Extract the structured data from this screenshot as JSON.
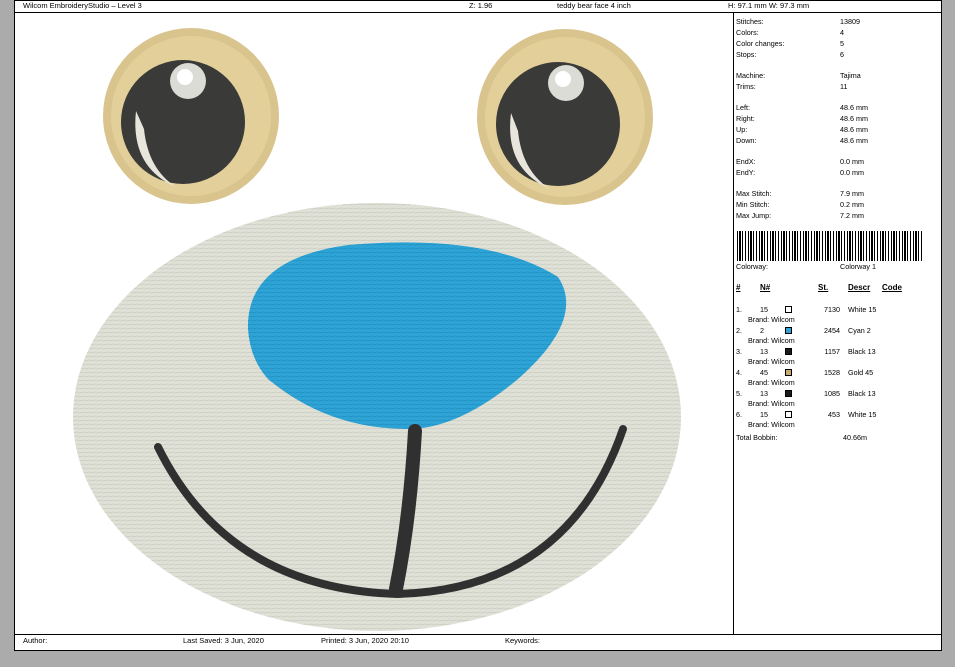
{
  "header": {
    "app": "Wilcom EmbroideryStudio – Level 3",
    "zoom": "Z: 1.96",
    "design": "teddy bear face 4 inch",
    "size": "H: 97.1 mm   W: 97.3 mm"
  },
  "stats": [
    {
      "label": "Stitches:",
      "value": "13809"
    },
    {
      "label": "Colors:",
      "value": "4"
    },
    {
      "label": "Color changes:",
      "value": "5"
    },
    {
      "label": "Stops:",
      "value": "6"
    },
    {
      "label": "Machine:",
      "value": "Tajima"
    },
    {
      "label": "Trims:",
      "value": "11"
    },
    {
      "label": "Left:",
      "value": "48.6 mm"
    },
    {
      "label": "Right:",
      "value": "48.6 mm"
    },
    {
      "label": "Up:",
      "value": "48.6 mm"
    },
    {
      "label": "Down:",
      "value": "48.6 mm"
    },
    {
      "label": "EndX:",
      "value": "0.0 mm"
    },
    {
      "label": "EndY:",
      "value": "0.0 mm"
    },
    {
      "label": "Max Stitch:",
      "value": "7.9 mm"
    },
    {
      "label": "Min Stitch:",
      "value": "0.2 mm"
    },
    {
      "label": "Max Jump:",
      "value": "7.2 mm"
    }
  ],
  "colorway": {
    "label": "Colorway:",
    "value": "Colorway 1"
  },
  "table_headers": {
    "num": "#",
    "n": "N#",
    "st": "St.",
    "descr": "Descr",
    "code": "Code"
  },
  "threads": [
    {
      "idx": "1.",
      "n": "15",
      "color": "#ffffff",
      "st": "7130",
      "descr": "White 15",
      "brand": "Brand: Wilcom"
    },
    {
      "idx": "2.",
      "n": "2",
      "color": "#2da3d6",
      "st": "2454",
      "descr": "Cyan 2",
      "brand": "Brand: Wilcom"
    },
    {
      "idx": "3.",
      "n": "13",
      "color": "#1a1a1a",
      "st": "1157",
      "descr": "Black 13",
      "brand": "Brand: Wilcom"
    },
    {
      "idx": "4.",
      "n": "45",
      "color": "#c9a96c",
      "st": "1528",
      "descr": "Gold 45",
      "brand": "Brand: Wilcom"
    },
    {
      "idx": "5.",
      "n": "13",
      "color": "#1a1a1a",
      "st": "1085",
      "descr": "Black 13",
      "brand": "Brand: Wilcom"
    },
    {
      "idx": "6.",
      "n": "15",
      "color": "#ffffff",
      "st": "453",
      "descr": "White 15",
      "brand": "Brand: Wilcom"
    }
  ],
  "total_bobbin": {
    "label": "Total Bobbin:",
    "value": "40.66m"
  },
  "footer": {
    "author": "Author:",
    "last_saved": "Last Saved:  3 Jun, 2020",
    "printed": "Printed:  3 Jun, 2020 20:10",
    "keywords": "Keywords:"
  },
  "colors": {
    "muzzle": "#dfe0d6",
    "nose": "#2da3d6",
    "eye_ring": "#d9c48e",
    "pupil": "#3a3a38",
    "mouth": "#303030"
  }
}
